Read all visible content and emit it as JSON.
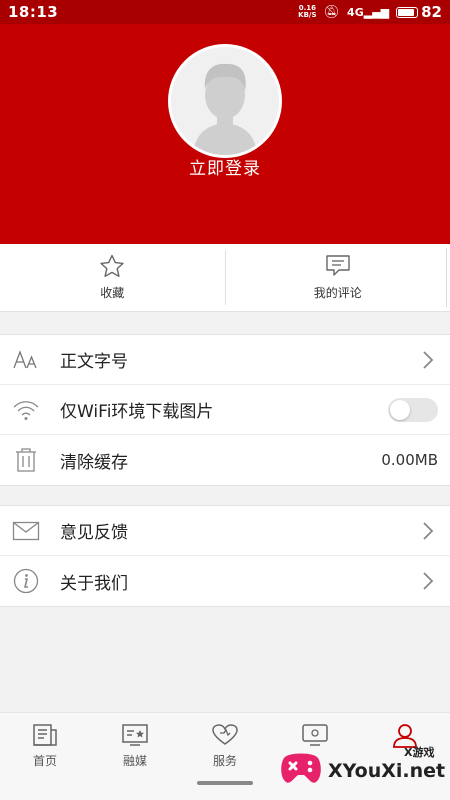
{
  "status_bar": {
    "time": "18:13",
    "net_speed": "0.16",
    "net_unit": "KB/S",
    "signal": "4G",
    "battery": "82"
  },
  "header": {
    "login_text": "立即登录"
  },
  "quick_actions": [
    {
      "label": "收藏",
      "icon": "star-icon"
    },
    {
      "label": "我的评论",
      "icon": "comment-icon"
    }
  ],
  "settings": {
    "font_size": {
      "label": "正文字号",
      "icon": "font-size-icon"
    },
    "wifi_images": {
      "label": "仅WiFi环境下载图片",
      "icon": "wifi-icon",
      "enabled": false
    },
    "clear_cache": {
      "label": "清除缓存",
      "icon": "trash-icon",
      "value": "0.00MB"
    },
    "feedback": {
      "label": "意见反馈",
      "icon": "mail-icon"
    },
    "about": {
      "label": "关于我们",
      "icon": "info-icon"
    }
  },
  "tabs": [
    {
      "label": "首页",
      "icon": "news-icon",
      "active": false
    },
    {
      "label": "融媒",
      "icon": "media-icon",
      "active": false
    },
    {
      "label": "服务",
      "icon": "heart-icon",
      "active": false
    },
    {
      "label": "",
      "icon": "message-icon",
      "active": false
    },
    {
      "label": "",
      "icon": "user-icon",
      "active": true
    }
  ],
  "watermark": {
    "name": "XYouXi.net",
    "sub": "X游戏"
  },
  "colors": {
    "brand_red": "#c40000",
    "status_bar": "#a80000"
  }
}
